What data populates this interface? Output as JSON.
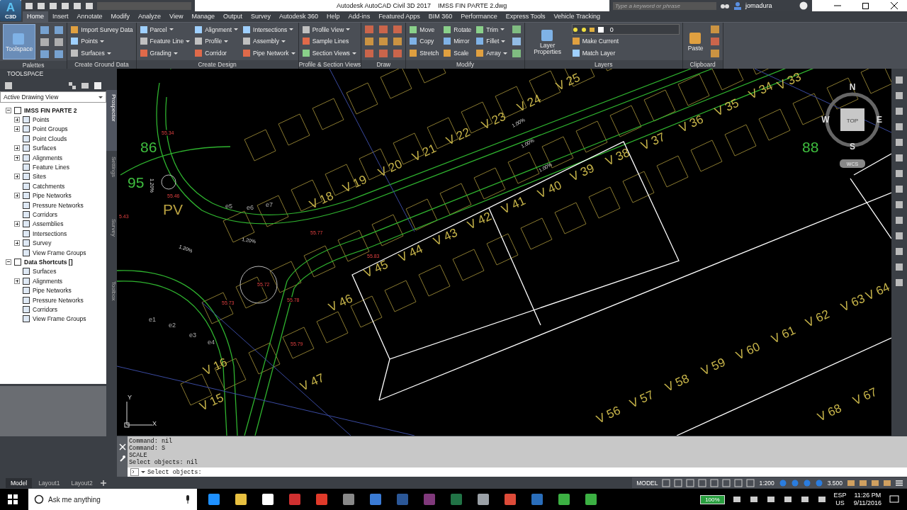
{
  "title_bar": {
    "logo": {
      "letter": "A",
      "caption": "C3D"
    },
    "app_title": "Autodesk AutoCAD Civil 3D 2017",
    "file_name": "IMSS FIN PARTE 2.dwg",
    "search_placeholder": "Type a keyword or phrase",
    "user": "jomadura"
  },
  "menu_tabs": [
    {
      "label": "Home",
      "selected": true
    },
    {
      "label": "Insert",
      "selected": false
    },
    {
      "label": "Annotate",
      "selected": false
    },
    {
      "label": "Modify",
      "selected": false
    },
    {
      "label": "Analyze",
      "selected": false
    },
    {
      "label": "View",
      "selected": false
    },
    {
      "label": "Manage",
      "selected": false
    },
    {
      "label": "Output",
      "selected": false
    },
    {
      "label": "Survey",
      "selected": false
    },
    {
      "label": "Autodesk 360",
      "selected": false
    },
    {
      "label": "Help",
      "selected": false
    },
    {
      "label": "Add-ins",
      "selected": false
    },
    {
      "label": "Featured Apps",
      "selected": false
    },
    {
      "label": "BIM 360",
      "selected": false
    },
    {
      "label": "Performance",
      "selected": false
    },
    {
      "label": "Express Tools",
      "selected": false
    },
    {
      "label": "Vehicle Tracking",
      "selected": false
    }
  ],
  "ribbon_panels": [
    {
      "title": "Palettes",
      "columns": [
        [
          {
            "kind": "large",
            "label": "Toolspace",
            "selected": true
          }
        ],
        [
          {
            "kind": "icon"
          },
          {
            "kind": "icon"
          },
          {
            "kind": "icon"
          }
        ],
        [
          {
            "kind": "icon"
          },
          {
            "kind": "icon"
          },
          {
            "kind": "icon"
          }
        ]
      ]
    },
    {
      "title": "Create Ground Data",
      "columns": [
        [
          {
            "kind": "small",
            "label": "Import Survey Data",
            "dropdown": false
          },
          {
            "kind": "small",
            "label": "Points",
            "dropdown": true
          },
          {
            "kind": "small",
            "label": "Surfaces",
            "dropdown": true
          }
        ]
      ]
    },
    {
      "title": "Create Design",
      "columns": [
        [
          {
            "kind": "small",
            "label": "Parcel",
            "dropdown": true
          },
          {
            "kind": "small",
            "label": "Feature Line",
            "dropdown": true
          },
          {
            "kind": "small",
            "label": "Grading",
            "dropdown": true
          }
        ],
        [
          {
            "kind": "small",
            "label": "Alignment",
            "dropdown": true
          },
          {
            "kind": "small",
            "label": "Profile",
            "dropdown": true
          },
          {
            "kind": "small",
            "label": "Corridor",
            "dropdown": false
          }
        ],
        [
          {
            "kind": "small",
            "label": "Intersections",
            "dropdown": true
          },
          {
            "kind": "small",
            "label": "Assembly",
            "dropdown": true
          },
          {
            "kind": "small",
            "label": "Pipe Network",
            "dropdown": true
          }
        ]
      ]
    },
    {
      "title": "Profile & Section Views",
      "columns": [
        [
          {
            "kind": "small",
            "label": "Profile View",
            "dropdown": true
          },
          {
            "kind": "small",
            "label": "Sample Lines",
            "dropdown": false
          },
          {
            "kind": "small",
            "label": "Section Views",
            "dropdown": true
          }
        ]
      ]
    },
    {
      "title": "Draw",
      "columns": [
        [
          {
            "kind": "icon"
          },
          {
            "kind": "icon"
          },
          {
            "kind": "icon"
          }
        ],
        [
          {
            "kind": "icon"
          },
          {
            "kind": "icon"
          },
          {
            "kind": "icon"
          }
        ],
        [
          {
            "kind": "icon"
          },
          {
            "kind": "icon"
          },
          {
            "kind": "icon"
          }
        ]
      ]
    },
    {
      "title": "Modify",
      "columns": [
        [
          {
            "kind": "small",
            "label": "Move",
            "dropdown": false
          },
          {
            "kind": "small",
            "label": "Copy",
            "dropdown": false
          },
          {
            "kind": "small",
            "label": "Stretch",
            "dropdown": false
          }
        ],
        [
          {
            "kind": "small",
            "label": "Rotate",
            "dropdown": false
          },
          {
            "kind": "small",
            "label": "Mirror",
            "dropdown": false
          },
          {
            "kind": "small",
            "label": "Scale",
            "dropdown": false
          }
        ],
        [
          {
            "kind": "small",
            "label": "Trim",
            "dropdown": true
          },
          {
            "kind": "small",
            "label": "Fillet",
            "dropdown": true
          },
          {
            "kind": "small",
            "label": "Array",
            "dropdown": true
          }
        ],
        [
          {
            "kind": "icon"
          },
          {
            "kind": "icon"
          },
          {
            "kind": "icon"
          }
        ]
      ]
    },
    {
      "title": "Layers",
      "columns": [
        [
          {
            "kind": "large",
            "label": "Layer Properties",
            "selected": false
          }
        ],
        [
          {
            "kind": "layer",
            "label": "0"
          },
          {
            "kind": "small",
            "label": "Make Current",
            "dropdown": false
          },
          {
            "kind": "small",
            "label": "Match Layer",
            "dropdown": false
          }
        ]
      ]
    },
    {
      "title": "Clipboard",
      "columns": [
        [
          {
            "kind": "large",
            "label": "Paste",
            "selected": false
          }
        ],
        [
          {
            "kind": "icon"
          },
          {
            "kind": "icon"
          },
          {
            "kind": "icon"
          }
        ]
      ]
    }
  ],
  "toolspace": {
    "title": "TOOLSPACE",
    "view": "Active Drawing View",
    "tree": [
      {
        "label": "IMSS FIN PARTE 2",
        "kind": "expanded",
        "children": [
          {
            "label": "Points",
            "kind": "collapsed"
          },
          {
            "label": "Point Groups",
            "kind": "collapsed"
          },
          {
            "label": "Point Clouds",
            "kind": "leaf"
          },
          {
            "label": "Surfaces",
            "kind": "collapsed"
          },
          {
            "label": "Alignments",
            "kind": "collapsed"
          },
          {
            "label": "Feature Lines",
            "kind": "leaf"
          },
          {
            "label": "Sites",
            "kind": "collapsed"
          },
          {
            "label": "Catchments",
            "kind": "leaf"
          },
          {
            "label": "Pipe Networks",
            "kind": "collapsed"
          },
          {
            "label": "Pressure Networks",
            "kind": "leaf"
          },
          {
            "label": "Corridors",
            "kind": "leaf"
          },
          {
            "label": "Assemblies",
            "kind": "collapsed"
          },
          {
            "label": "Intersections",
            "kind": "leaf"
          },
          {
            "label": "Survey",
            "kind": "collapsed"
          },
          {
            "label": "View Frame Groups",
            "kind": "leaf"
          }
        ]
      },
      {
        "label": "Data Shortcuts []",
        "kind": "expanded",
        "children": [
          {
            "label": "Surfaces",
            "kind": "leaf"
          },
          {
            "label": "Alignments",
            "kind": "collapsed"
          },
          {
            "label": "Pipe Networks",
            "kind": "leaf"
          },
          {
            "label": "Pressure Networks",
            "kind": "leaf"
          },
          {
            "label": "Corridors",
            "kind": "leaf"
          },
          {
            "label": "View Frame Groups",
            "kind": "leaf"
          }
        ]
      }
    ],
    "side_tabs": [
      {
        "label": "Prospector",
        "selected": true
      },
      {
        "label": "Settings",
        "selected": false
      },
      {
        "label": "Survey",
        "selected": false
      },
      {
        "label": "Toolbox",
        "selected": false
      }
    ]
  },
  "drawing": {
    "lot_labels": [
      "V 25",
      "V 24",
      "V 23",
      "V 22",
      "V 21",
      "V 20",
      "V 19",
      "V 18",
      "V 33",
      "V 34",
      "V 35",
      "V 36",
      "V 37",
      "V 38",
      "V 39",
      "V 40",
      "V 41",
      "V 42",
      "V 43",
      "V 44",
      "V 45",
      "V 46",
      "V 47",
      "V 16",
      "V 15",
      "V 56",
      "V 57",
      "V 58",
      "V 59",
      "V 60",
      "V 61",
      "V 62",
      "V 63",
      "V 64",
      "V 67",
      "V 68"
    ],
    "block_labels": [
      "86",
      "95",
      "88",
      "PV"
    ],
    "point_labels": [
      "e5",
      "e6",
      "e7",
      "e1",
      "e2",
      "e3",
      "e4"
    ],
    "elevations": [
      "55.34",
      "55.46",
      "55.77",
      "55.83",
      "55.72",
      "55.78",
      "55.73",
      "55.79",
      "5.43"
    ],
    "slopes": [
      "1.00%",
      "1.00%",
      "1.00%",
      "1.20%",
      "1.20%",
      "1.20%"
    ],
    "view_cube": {
      "north": "N",
      "south": "S",
      "east": "E",
      "west": "W",
      "face": "TOP",
      "ucs": "WCS"
    },
    "ucs_icon": {
      "y": "Y",
      "x": "X"
    }
  },
  "command_line": {
    "history": [
      "Command: nil",
      "Command: S",
      "SCALE",
      "Select objects: nil"
    ],
    "prompt": "Select objects:"
  },
  "layout_tabs": [
    {
      "label": "Model",
      "selected": true
    },
    {
      "label": "Layout1",
      "selected": false
    },
    {
      "label": "Layout2",
      "selected": false
    }
  ],
  "status_bar": {
    "space": "MODEL",
    "scale": "1:200",
    "value": "3.500"
  },
  "taskbar": {
    "search_placeholder": "Ask me anything",
    "battery": "100%",
    "language": "ESP",
    "region": "US",
    "time": "11:26 PM",
    "date": "9/11/2016"
  }
}
